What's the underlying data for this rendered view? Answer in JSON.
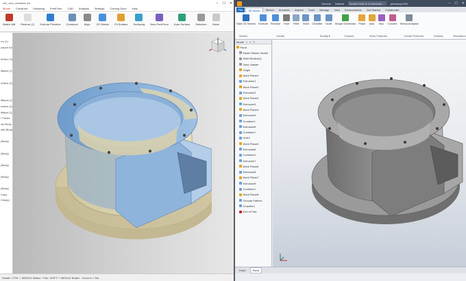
{
  "left_window": {
    "title": "mill_cam_database.ipt",
    "window_controls": {
      "minimize": "–",
      "maximize": "☐",
      "close": "✕"
    },
    "menu": [
      "Model",
      "Construct",
      "Surfacing",
      "FreeForm",
      "CAD",
      "Analysis",
      "Settings",
      "Coming Soon",
      "Help"
    ],
    "menu_active_index": 0,
    "ribbon": [
      {
        "label": "Watch Mill",
        "icon": "mill-icon",
        "color": "#c0392b"
      },
      {
        "label": "Restore (1)",
        "icon": "restore-icon",
        "color": "#dddddd"
      },
      {
        "label": "Extrude Primitive",
        "icon": "extrude-icon",
        "color": "#2f7dd1"
      },
      {
        "label": "Construct",
        "icon": "construct-icon",
        "color": "#6c8fb5"
      },
      {
        "label": "Align",
        "icon": "align-icon",
        "color": "#8a8a8a"
      },
      {
        "label": "2D Sketch",
        "icon": "sketch-icon",
        "color": "#4a90d9"
      },
      {
        "label": "Fit Surface",
        "icon": "fit-surface-icon",
        "color": "#e0a030"
      },
      {
        "label": "Surfacing",
        "icon": "surfacing-icon",
        "color": "#3aa0c8"
      },
      {
        "label": "New FreeForm",
        "icon": "freeform-icon",
        "color": "#7b5fbf"
      },
      {
        "label": "Auto Surface",
        "icon": "auto-surface-icon",
        "color": "#2f9e7a"
      },
      {
        "label": "Selection",
        "icon": "selection-icon",
        "color": "#999999"
      },
      {
        "label": "Mesh",
        "icon": "mesh-icon",
        "color": "#c9c9c9"
      }
    ],
    "side_panel": [
      "",
      "rm (1)",
      "ustom Edit",
      "",
      "lection Opt",
      "",
      "ltifacet (1)",
      "",
      "urface (1)",
      "",
      "",
      "ltifacet (1)",
      "urface (1)",
      "ltifacet (1)",
      "r Faces",
      "old Body",
      "olid (Body)",
      "",
      "(Body)",
      "",
      "(Body)",
      "",
      "(Body)",
      "",
      "(Body)",
      "",
      "(Body)",
      "Copy",
      "t Body)",
      "",
      "",
      "",
      "",
      "",
      "",
      "",
      "",
      "",
      "",
      "",
      "",
      ""
    ],
    "status_text": "Rotate: CTRL + MIDDLE Button · Pan: SHIFT + MIDDLE Button · Zoom In / Out",
    "model_colors": {
      "blue": "#7ba7d6",
      "tan": "#dcd3b1"
    }
  },
  "right_window": {
    "title_items": [
      "Generic",
      "Default",
      "Search Help & Commands..."
    ],
    "user": "ptmasury1000",
    "window_controls": {
      "minimize": "–",
      "maximize": "☐",
      "close": "✕"
    },
    "tabs": [
      "File",
      "3D Model",
      "Sketch",
      "Annotate",
      "Inspect",
      "Tools",
      "Manage",
      "View",
      "Environments",
      "Get Started",
      "Collaborate"
    ],
    "tab_active_index": 1,
    "ribbon": [
      {
        "label": "Start 2D Sketch",
        "icon": "sketch-icon",
        "color": "#2d6fbd"
      },
      {
        "label": "Extrude",
        "icon": "extrude-icon",
        "color": "#4f8ed8"
      },
      {
        "label": "Revolve",
        "icon": "revolve-icon",
        "color": "#4f8ed8"
      },
      {
        "label": "Hole",
        "icon": "hole-icon",
        "color": "#7a7a7a"
      },
      {
        "label": "Fillet",
        "icon": "fillet-icon",
        "color": "#8aa6c6"
      },
      {
        "label": "Shell",
        "icon": "shell-icon",
        "color": "#6b93c4"
      },
      {
        "label": "Chamfer",
        "icon": "chamfer-icon",
        "color": "#6b93c4"
      },
      {
        "label": "Draft",
        "icon": "draft-icon",
        "color": "#6b93c4"
      },
      {
        "label": "Shape Generator",
        "icon": "shape-generator-icon",
        "color": "#43a047"
      },
      {
        "label": "Plane",
        "icon": "plane-icon",
        "color": "#e3a63a"
      },
      {
        "label": "Axis",
        "icon": "axis-icon",
        "color": "#e3a63a"
      },
      {
        "label": "Box",
        "icon": "box-icon",
        "color": "#9c5fbf"
      },
      {
        "label": "Convert",
        "icon": "convert-icon",
        "color": "#c05d8f"
      },
      {
        "label": "Stress Analysis",
        "icon": "stress-icon",
        "color": "#7c8c9c"
      }
    ],
    "ribbon_groups": [
      {
        "label": "Sketch"
      },
      {
        "label": "Create"
      },
      {
        "label": "Modify ▾"
      },
      {
        "label": "Explore"
      },
      {
        "label": "Work Features"
      },
      {
        "label": "Create Freeform"
      },
      {
        "label": "Surface"
      },
      {
        "label": "Simulation"
      }
    ],
    "browser": {
      "header_label": "Model",
      "items": [
        {
          "label": "Part4",
          "color": "#e8a21a"
        },
        {
          "label": "Model States: Model",
          "color": "#999999"
        },
        {
          "label": "Solid Bodies(1)",
          "color": "#999999"
        },
        {
          "label": "View: Master",
          "color": "#999999"
        },
        {
          "label": "Origin",
          "color": "#e8a21a"
        },
        {
          "label": "Work Plane1",
          "color": "#e8a21a"
        },
        {
          "label": "Extrusion1",
          "color": "#6aa0d8"
        },
        {
          "label": "Work Plane2",
          "color": "#e8a21a"
        },
        {
          "label": "Extrusion2",
          "color": "#6aa0d8"
        },
        {
          "label": "Work Plane3",
          "color": "#e8a21a"
        },
        {
          "label": "Extrusion3",
          "color": "#6aa0d8"
        },
        {
          "label": "Work Plane4",
          "color": "#e8a21a"
        },
        {
          "label": "Extrusion4",
          "color": "#6aa0d8"
        },
        {
          "label": "Combine1",
          "color": "#6aa0d8"
        },
        {
          "label": "Extrusion5",
          "color": "#6aa0d8"
        },
        {
          "label": "Combine2",
          "color": "#6aa0d8"
        },
        {
          "label": "Hole1",
          "color": "#6aa0d8"
        },
        {
          "label": "Work Plane5",
          "color": "#e8a21a"
        },
        {
          "label": "Extrusion6",
          "color": "#6aa0d8"
        },
        {
          "label": "Combine3",
          "color": "#6aa0d8"
        },
        {
          "label": "Extrusion7",
          "color": "#6aa0d8"
        },
        {
          "label": "Work Plane6",
          "color": "#e8a21a"
        },
        {
          "label": "Extrusion8",
          "color": "#6aa0d8"
        },
        {
          "label": "Work Plane7",
          "color": "#e8a21a"
        },
        {
          "label": "Extrusion9",
          "color": "#6aa0d8"
        },
        {
          "label": "Combine4",
          "color": "#6aa0d8"
        },
        {
          "label": "Work Plane8",
          "color": "#e8a21a"
        },
        {
          "label": "Circular Pattern",
          "color": "#6aa0d8"
        },
        {
          "label": "Chamfer1",
          "color": "#6aa0d8"
        },
        {
          "label": "End of Part",
          "color": "#c62828"
        }
      ]
    },
    "doc_tabs": [
      "Part1",
      "Part4"
    ],
    "doc_tab_active_index": 1,
    "model_color": "#8a8a8a"
  }
}
